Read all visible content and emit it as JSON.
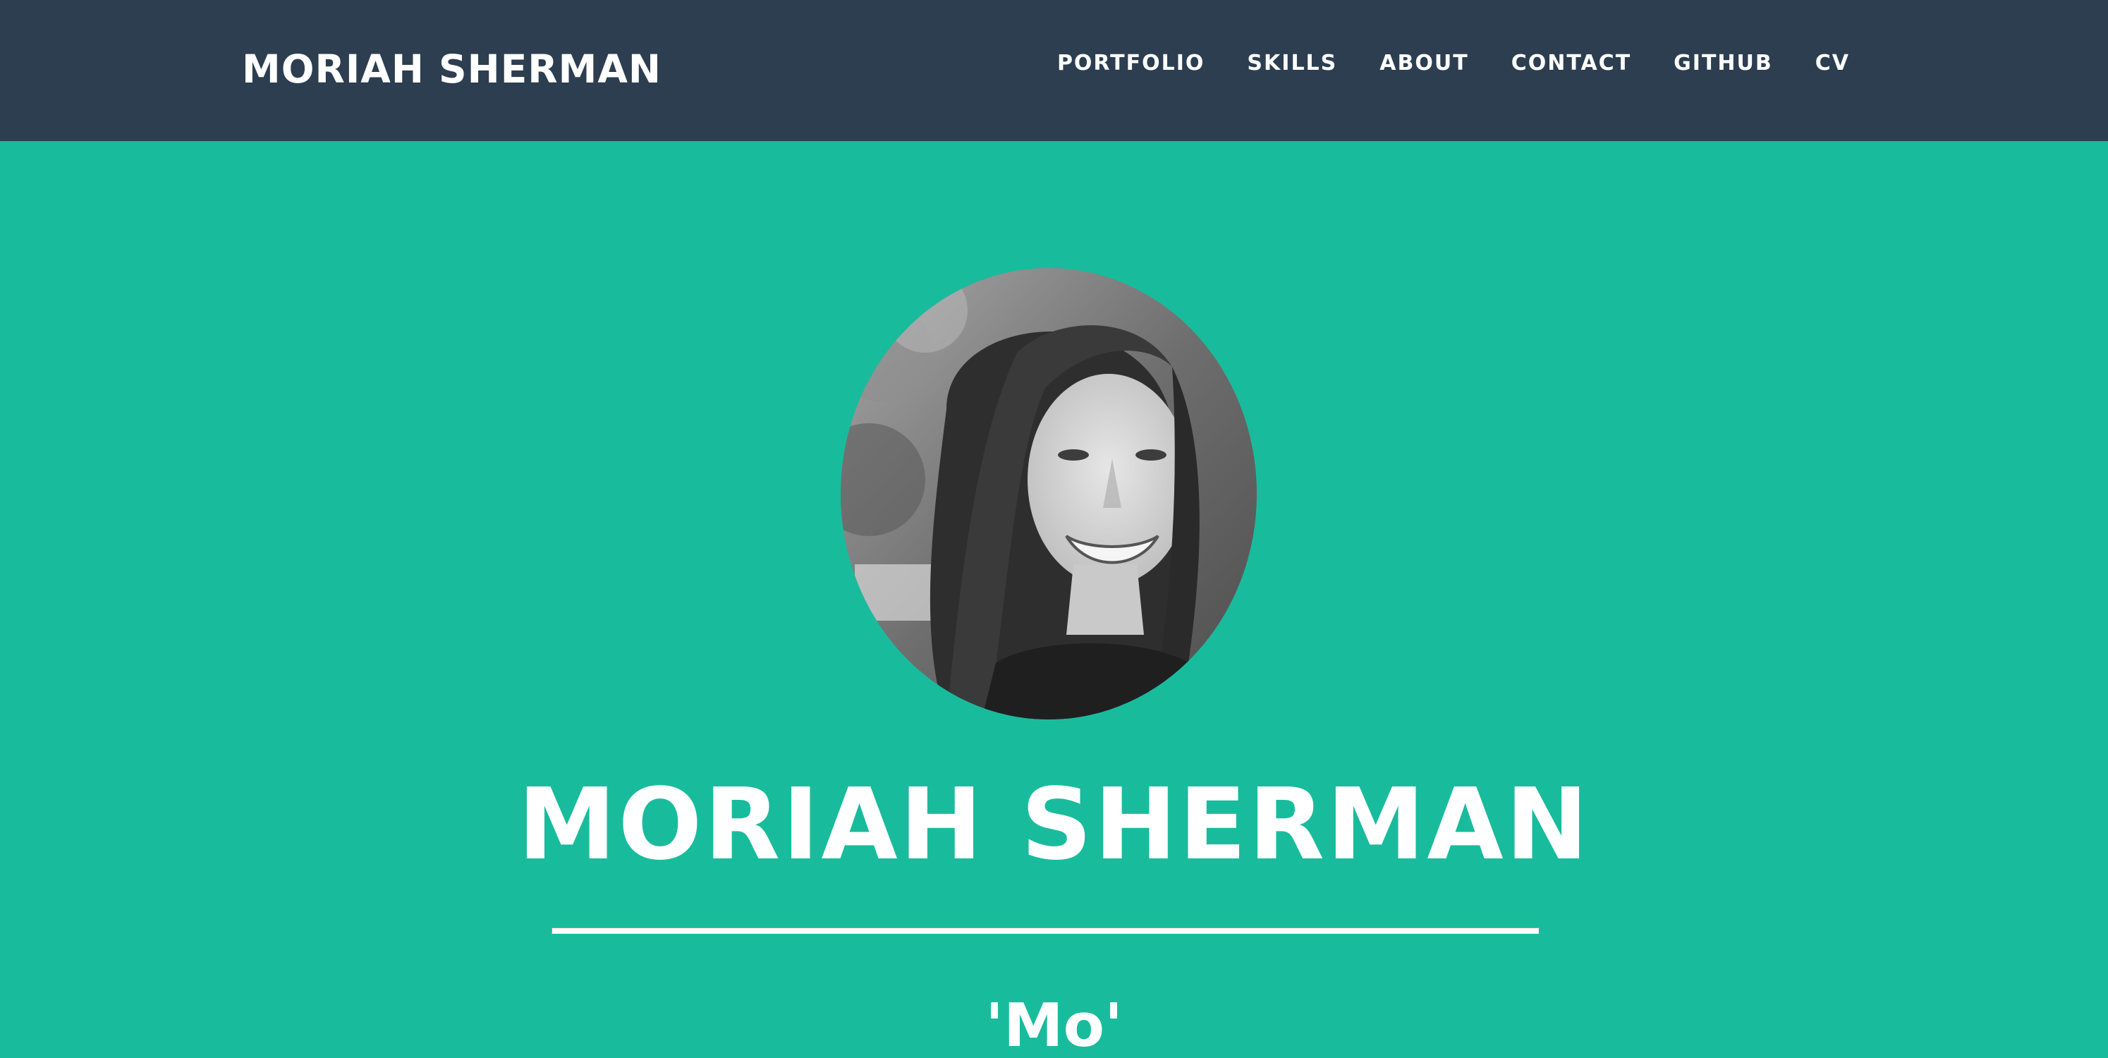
{
  "navbar": {
    "brand": "MORIAH SHERMAN",
    "links": [
      "PORTFOLIO",
      "SKILLS",
      "ABOUT",
      "CONTACT",
      "GITHUB",
      "CV"
    ]
  },
  "hero": {
    "title": "MORIAH SHERMAN",
    "nickname": "'Mo'"
  },
  "colors": {
    "navbar_bg": "#2c3e50",
    "hero_bg": "#18bc9c",
    "text": "#ffffff"
  }
}
